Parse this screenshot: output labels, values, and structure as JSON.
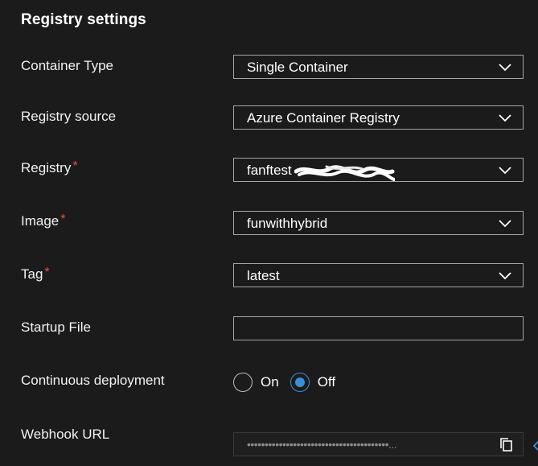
{
  "section_title": "Registry settings",
  "fields": {
    "container_type": {
      "label": "Container Type",
      "value": "Single Container"
    },
    "registry_source": {
      "label": "Registry source",
      "value": "Azure Container Registry"
    },
    "registry": {
      "label": "Registry",
      "value": "fanftest",
      "required_mark": "*",
      "redacted": true
    },
    "image": {
      "label": "Image",
      "value": "funwithhybrid",
      "required_mark": "*"
    },
    "tag": {
      "label": "Tag",
      "value": "latest",
      "required_mark": "*"
    },
    "startup_file": {
      "label": "Startup File",
      "value": ""
    },
    "continuous_deployment": {
      "label": "Continuous deployment",
      "options": [
        "On",
        "Off"
      ],
      "selected": "Off"
    },
    "webhook_url": {
      "label": "Webhook URL",
      "masked_value": "••••••••••••••••••••••••••••••••••••••••..."
    }
  },
  "icons": {
    "dropdown": "chevron-down-icon",
    "copy": "copy-icon",
    "edge": "chevron-left-icon"
  },
  "colors": {
    "background": "#1b1b1b",
    "border": "#a6a6a6",
    "accent": "#3b8fd9",
    "required": "#f04a4a"
  }
}
